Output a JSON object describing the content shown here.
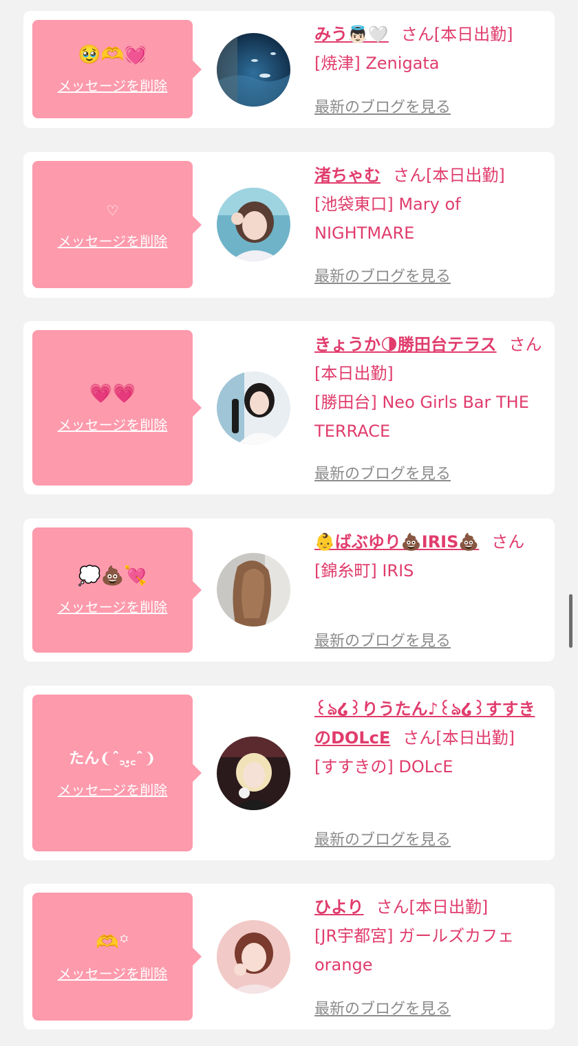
{
  "common": {
    "delete_label": "メッセージを削除",
    "blog_label": "最新のブログを見る",
    "san_label": "さん",
    "today_label": "[本日出勤]"
  },
  "cards": [
    {
      "message": "🥹🫶💓",
      "name": "みう👼🏻🤍",
      "suffix": "さん[本日出勤]",
      "shop": "[焼津] Zenigata"
    },
    {
      "message": "♡",
      "name": "渚ちゃむ",
      "suffix": "さん[本日出勤]",
      "shop": "[池袋東口] Mary of NIGHTMARE"
    },
    {
      "message": "💗💗",
      "name": "きょうか🌗勝田台テラス",
      "suffix": "さん[本日出勤]",
      "shop": "[勝田台] Neo Girls Bar THE TERRACE"
    },
    {
      "message": "💭💩💘",
      "name": "👶ばぶゆり💩IRIS💩",
      "suffix": "さん",
      "shop": "[錦糸町] IRIS"
    },
    {
      "message": "たん❨ˆ꜆.̮꜀ˆ❩",
      "name": "꒰ঌ໒꒱りうたん♪꒰ঌ໒꒱すすきのDOLcE",
      "suffix": "さん[本日出勤]",
      "shop": "[すすきの] DOLcE"
    },
    {
      "message": "🫶꙳",
      "name": "ひより",
      "suffix": "さん[本日出勤]",
      "shop": "[JR宇都宮] ガールズカフェ orange"
    }
  ]
}
